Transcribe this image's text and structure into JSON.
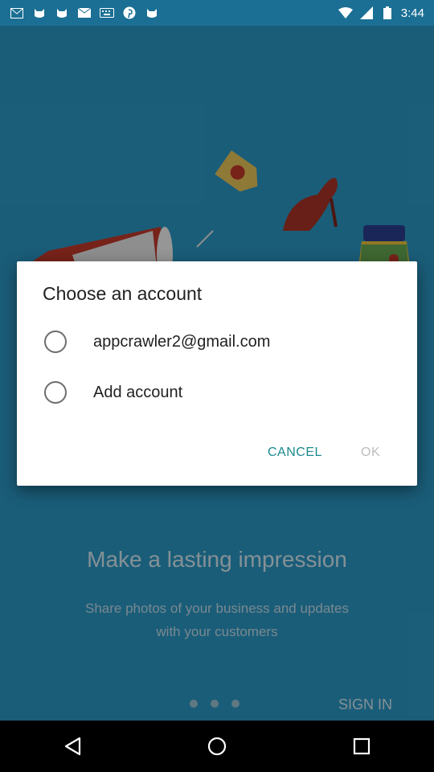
{
  "status_bar": {
    "time": "3:44",
    "left_icons": [
      "gmail-icon",
      "cat-icon",
      "cat-icon",
      "mail-icon",
      "keyboard-icon",
      "pinterest-icon",
      "cat-icon"
    ],
    "right_icons": [
      "wifi-icon",
      "signal-icon",
      "battery-icon"
    ]
  },
  "background": {
    "headline": "Make a lasting impression",
    "subtext": "Share photos of your business and updates with your customers",
    "sign_in": "SIGN IN",
    "page_dots": 3
  },
  "dialog": {
    "title": "Choose an account",
    "options": [
      {
        "label": "appcrawler2@gmail.com",
        "selected": false
      },
      {
        "label": "Add account",
        "selected": false
      }
    ],
    "cancel_label": "CANCEL",
    "ok_label": "OK"
  },
  "nav_bar": {
    "icons": [
      "back-icon",
      "home-icon",
      "recents-icon"
    ]
  },
  "colors": {
    "accent": "#1b8a8e",
    "status_bar": "#1b6f94",
    "background": "#2a97c4"
  }
}
